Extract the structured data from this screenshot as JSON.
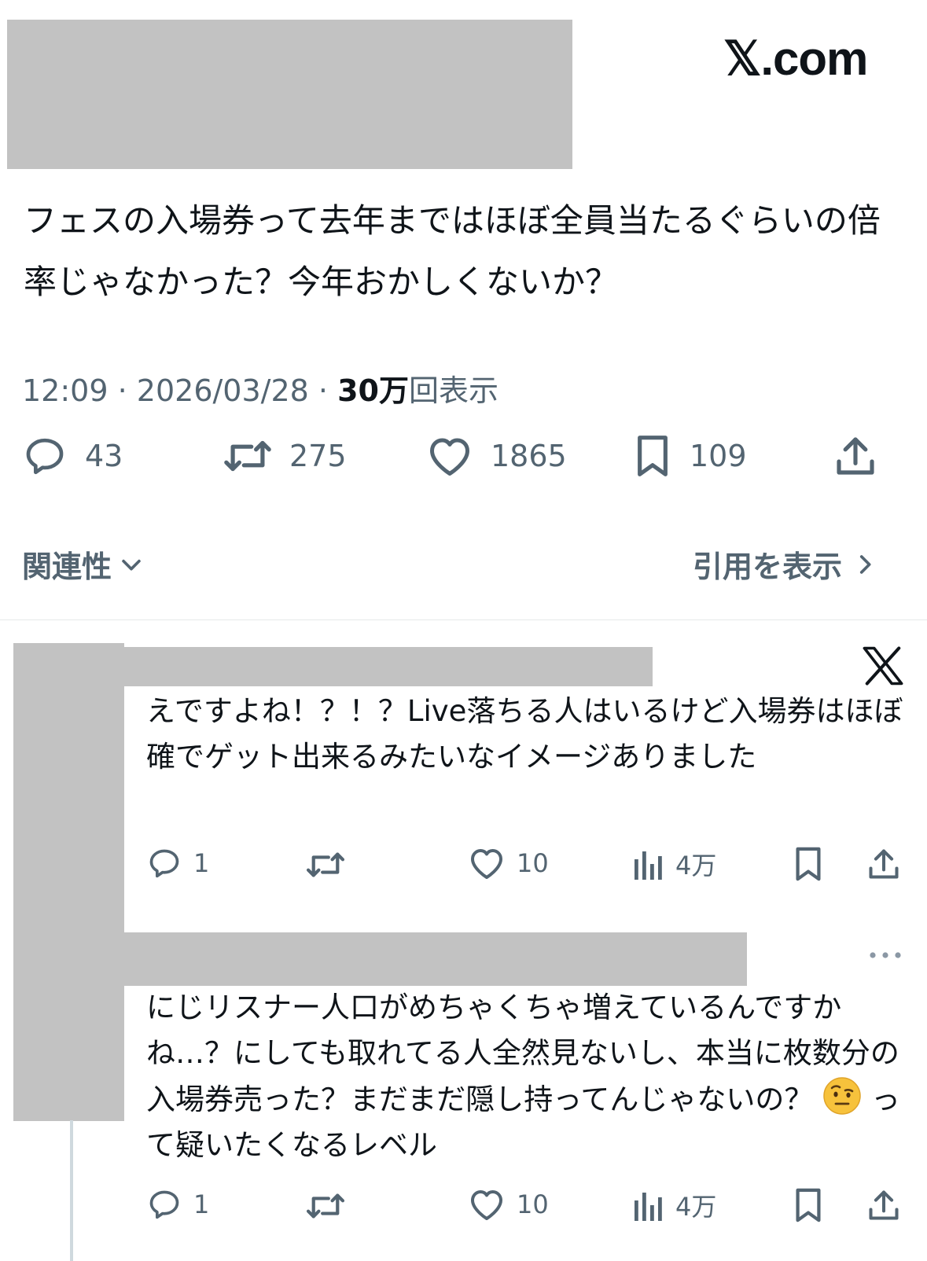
{
  "brand": {
    "text": "𝕏.com"
  },
  "post": {
    "text": "フェスの入場券って去年まではほぼ全員当たるぐらいの倍率じゃなかった？今年おかしくないか？",
    "time": "12:09",
    "date": "2026/03/28",
    "separator": "·",
    "views_count": "30万",
    "views_label": "回表示",
    "actions": {
      "replies": "43",
      "reposts": "275",
      "likes": "1865",
      "bookmarks": "109"
    },
    "relevance_label": "関連性",
    "quotes_label": "引用を表示"
  },
  "replies": [
    {
      "text": "えですよね！？！？Live落ちる人はいるけど入場券はほぼ確でゲット出来るみたいなイメージありました",
      "actions": {
        "replies": "1",
        "reposts": "",
        "likes": "10",
        "views": "4万"
      }
    },
    {
      "text_before": "にじリスナー人口がめちゃくちゃ増えているんですかね…？にしても取れてる人全然見ないし、本当に枚数分の入場券売った？まだまだ隠し持ってんじゃないの？",
      "emoji": "raised-eyebrow-face",
      "text_after": "って疑いたくなるレベル",
      "actions": {
        "replies": "1",
        "reposts": "",
        "likes": "10",
        "views": "4万"
      }
    }
  ],
  "icons": {
    "reply": "reply-icon",
    "repost": "repost-icon",
    "like": "heart-icon",
    "bookmark": "bookmark-icon",
    "share": "share-icon",
    "views": "analytics-icon",
    "x_logo": "x-logo-icon",
    "more": "more-icon"
  },
  "colors": {
    "text": "#0f1419",
    "secondary": "#536471",
    "redaction": "#c2c2c2",
    "divider": "#e6e9ea"
  }
}
